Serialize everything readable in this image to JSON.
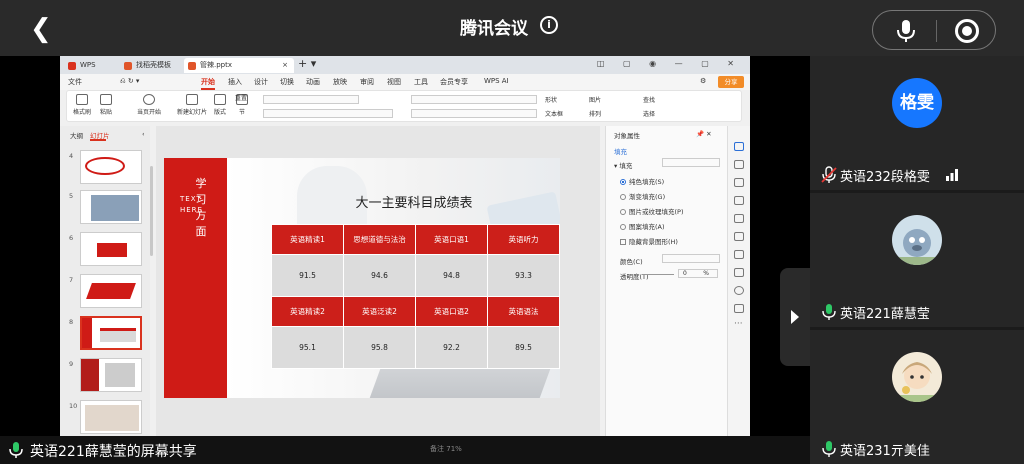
{
  "topbar": {
    "title": "腾讯会议",
    "info_symbol": "i"
  },
  "wps": {
    "tabs": [
      "WPS Office",
      "找稻壳模板",
      "管辣.pptx"
    ],
    "menu": [
      "文件",
      "开始",
      "插入",
      "设计",
      "切换",
      "动画",
      "放映",
      "审阅",
      "视图",
      "工具",
      "会员专享",
      "WPS AI"
    ],
    "active_menu": "开始",
    "share_label": "分享",
    "ribbon_labels": [
      "格式刷",
      "粘贴",
      "当页开始",
      "新建幻灯片",
      "版式",
      "节",
      "重置",
      "形状",
      "图片",
      "文本框",
      "排列",
      "查找",
      "选择"
    ],
    "panel_tabs": [
      "大纲",
      "幻灯片"
    ],
    "slide_numbers": [
      "4",
      "5",
      "6",
      "7",
      "8",
      "9",
      "10"
    ],
    "props": {
      "title": "对象属性",
      "section_tab": "填充",
      "fill_group": "填充",
      "options": [
        "纯色填充(S)",
        "渐变填充(G)",
        "图片或纹理填充(P)",
        "图案填充(A)"
      ],
      "hide_bg": "隐藏背景图形(H)",
      "color_label": "颜色(C)",
      "transparency_label": "透明度(T)",
      "transparency_value": "0",
      "percent": "%"
    },
    "status_bits": [
      "备注",
      "71%"
    ]
  },
  "slide": {
    "side_text_cn": "学习方面",
    "side_text_en": "TEXT HERE",
    "title": "大一主要科目成绩表",
    "header_row1": [
      "英语精读1",
      "思想道德与法治",
      "英语口语1",
      "英语听力"
    ],
    "value_row1": [
      "91.5",
      "94.6",
      "94.8",
      "93.3"
    ],
    "header_row2": [
      "英语精读2",
      "英语泛读2",
      "英语口语2",
      "英语语法"
    ],
    "value_row2": [
      "95.1",
      "95.8",
      "92.2",
      "89.5"
    ]
  },
  "share_caption": "英语221薛慧莹的屏幕共享",
  "participants": [
    {
      "name": "英语232段格雯",
      "avatar_text": "格雯",
      "muted": true
    },
    {
      "name": "英语221薛慧莹",
      "avatar_text": "",
      "muted": false
    },
    {
      "name": "英语231亓美佳",
      "avatar_text": "",
      "muted": false
    }
  ],
  "colors": {
    "accent_red": "#cf1b16",
    "wps_orange": "#f28c28",
    "avatar_blue": "#1677ff",
    "mic_green": "#2ec866"
  }
}
